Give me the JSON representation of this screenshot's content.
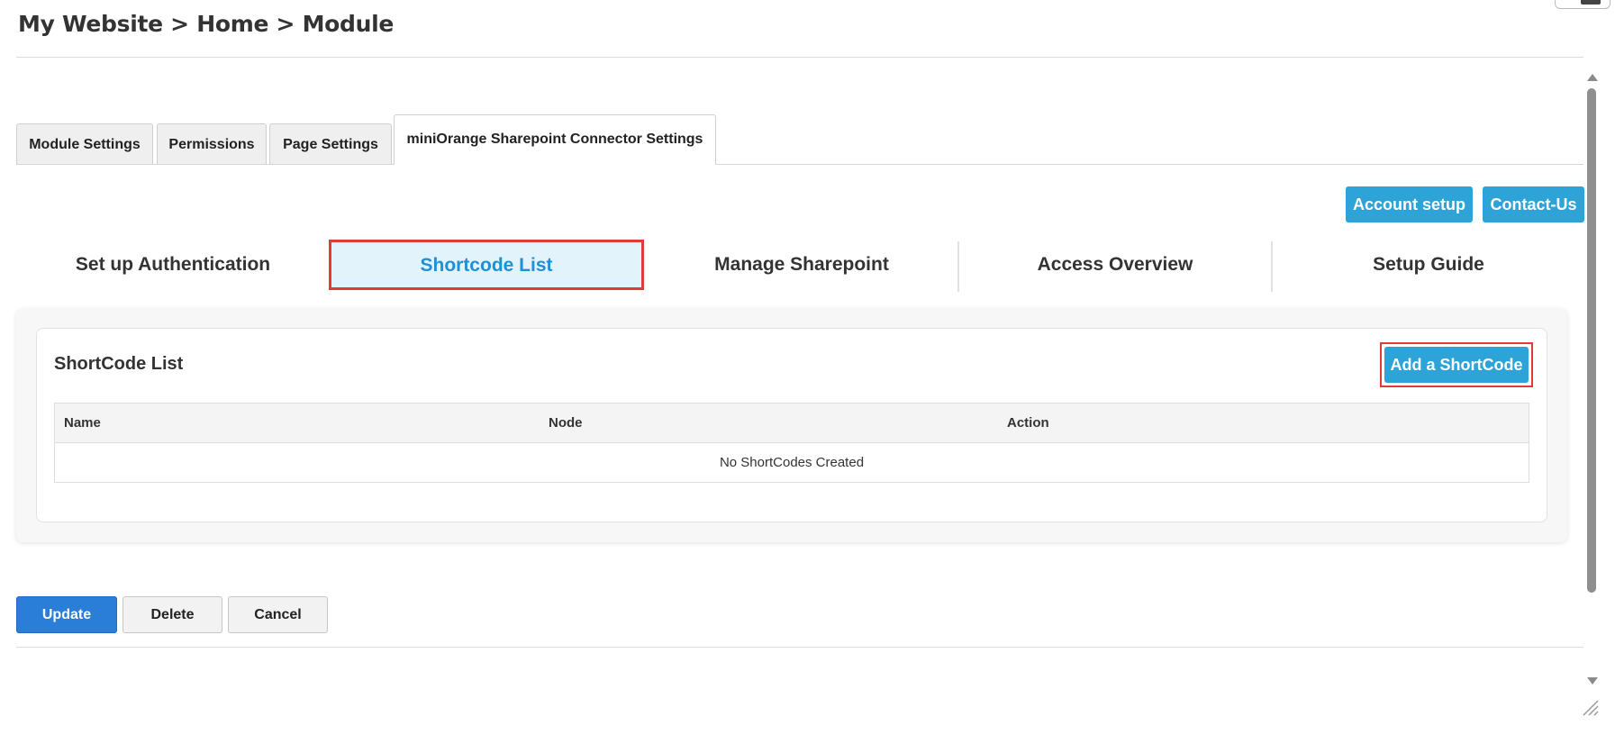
{
  "breadcrumb": "My Website > Home > Module",
  "page_tabs": [
    {
      "label": "Module Settings"
    },
    {
      "label": "Permissions"
    },
    {
      "label": "Page Settings"
    },
    {
      "label": "miniOrange Sharepoint Connector Settings",
      "active": true
    }
  ],
  "top_buttons": {
    "account_setup": "Account setup",
    "contact_us": "Contact-Us"
  },
  "sub_tabs": [
    {
      "label": "Set up Authentication"
    },
    {
      "label": "Shortcode List",
      "active": true
    },
    {
      "label": "Manage Sharepoint"
    },
    {
      "label": "Access Overview"
    },
    {
      "label": "Setup Guide"
    }
  ],
  "panel": {
    "title": "ShortCode List",
    "add_button": "Add a ShortCode",
    "columns": [
      "Name",
      "Node",
      "Action"
    ],
    "empty_message": "No ShortCodes Created"
  },
  "footer_buttons": {
    "update": "Update",
    "delete": "Delete",
    "cancel": "Cancel"
  },
  "colors": {
    "accent": "#2ea3d8",
    "primary": "#2a7ed8",
    "highlight": "#e03a3a",
    "active_tab_text": "#1e90d6"
  }
}
